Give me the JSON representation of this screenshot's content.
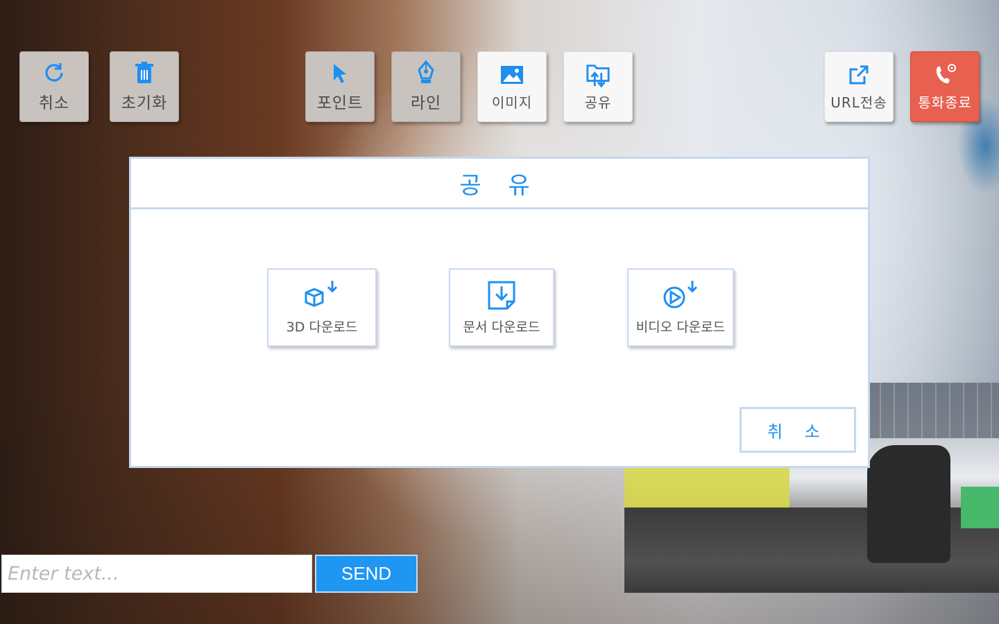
{
  "toolbar": {
    "left": [
      {
        "label": "취소",
        "icon": "undo-icon"
      },
      {
        "label": "초기화",
        "icon": "trash-icon"
      }
    ],
    "center": [
      {
        "label": "포인트",
        "icon": "pointer-icon"
      },
      {
        "label": "라인",
        "icon": "pen-icon"
      },
      {
        "label": "이미지",
        "icon": "image-icon"
      },
      {
        "label": "공유",
        "icon": "share-folder-icon"
      }
    ],
    "right": [
      {
        "label": "URL전송",
        "icon": "external-link-icon"
      },
      {
        "label": "통화종료",
        "icon": "end-call-icon"
      }
    ]
  },
  "dialog": {
    "title": "공 유",
    "options": [
      {
        "label": "3D 다운로드",
        "icon": "cube-download-icon"
      },
      {
        "label": "문서 다운로드",
        "icon": "document-download-icon"
      },
      {
        "label": "비디오 다운로드",
        "icon": "video-download-icon"
      }
    ],
    "cancel_label": "취 소"
  },
  "chat": {
    "placeholder": "Enter text...",
    "send_label": "SEND"
  },
  "colors": {
    "accent": "#1f8ff0",
    "end_call": "#e8604f",
    "tool_gray": "#c9c3bf"
  }
}
